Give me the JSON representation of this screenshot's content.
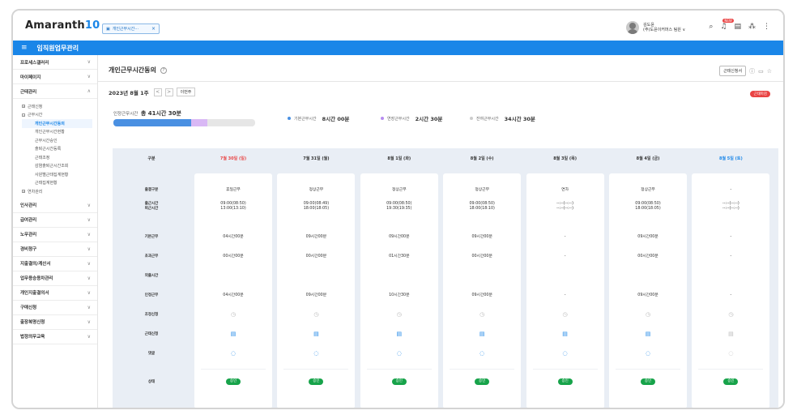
{
  "app": {
    "logo_text": "Amaranth",
    "logo_num": "10",
    "tab_label": "개인근무시간···",
    "tab_close": "×",
    "user_name": "김도윤",
    "user_dept": "(주)도윤이커머스 팀원 ∨",
    "new_badge": "NEW",
    "module_title": "임직원업무관리"
  },
  "sidebar": {
    "menus_top": [
      {
        "label": "프로세스갤러리",
        "chev": "∨"
      },
      {
        "label": "마이페이지",
        "chev": "∨"
      },
      {
        "label": "근태관리",
        "chev": "∧"
      }
    ],
    "sub_items": [
      {
        "label": "근태신청",
        "marker": "+",
        "child": false,
        "active": false
      },
      {
        "label": "근무시간",
        "marker": "−",
        "child": false,
        "active": false
      },
      {
        "label": "개인근무시간동의",
        "marker": "",
        "child": true,
        "active": true
      },
      {
        "label": "개인근무시간현황",
        "marker": "",
        "child": true,
        "active": false
      },
      {
        "label": "근무시간승인",
        "marker": "",
        "child": true,
        "active": false
      },
      {
        "label": "출퇴근시간등록",
        "marker": "",
        "child": true,
        "active": false
      },
      {
        "label": "근태조정",
        "marker": "",
        "child": true,
        "active": false
      },
      {
        "label": "감염출퇴근시간조회",
        "marker": "",
        "child": true,
        "active": false
      },
      {
        "label": "사원별근태집계현황",
        "marker": "",
        "child": true,
        "active": false
      },
      {
        "label": "근태집계현황",
        "marker": "",
        "child": true,
        "active": false
      },
      {
        "label": "연차관리",
        "marker": "+",
        "child": false,
        "active": false
      }
    ],
    "menus_bottom": [
      {
        "label": "인사관리",
        "chev": "∨"
      },
      {
        "label": "급여관리",
        "chev": "∨"
      },
      {
        "label": "노무관리",
        "chev": "∨"
      },
      {
        "label": "경비청구",
        "chev": "∨"
      },
      {
        "label": "지출결의/계산서",
        "chev": "∨"
      },
      {
        "label": "업무용승용차관리",
        "chev": "∨"
      },
      {
        "label": "개인지출결의서",
        "chev": "∨"
      },
      {
        "label": "구매신청",
        "chev": "∨"
      },
      {
        "label": "출장복명신청",
        "chev": "∨"
      },
      {
        "label": "법정의무교육",
        "chev": "∨"
      }
    ]
  },
  "page": {
    "title": "개인근무시간동의",
    "help": "?",
    "request_button": "근태신청서",
    "week_label": "2023년 8월 1주",
    "prev": "<",
    "next": ">",
    "this_week_button": "이번주",
    "status_badge": "근태마감"
  },
  "summary": {
    "total_label": "인정근무시간",
    "total_value": "총 41시간 30분",
    "basic_ratio": 0.55,
    "extend_ratio": 0.11,
    "legend": [
      {
        "label": "기본근무시간",
        "value": "8시간 00분",
        "color": "#4a90e2"
      },
      {
        "label": "연장근무시간",
        "value": "2시간 30분",
        "color": "#b68cf0"
      },
      {
        "label": "잔여근무시간",
        "value": "34시간 30분",
        "color": "#cccccc"
      }
    ]
  },
  "table": {
    "header_label": "구분",
    "row_labels": [
      "출결구분",
      "출근시간\n퇴근시간",
      "기본근무",
      "초과근무",
      "외출시간",
      "인정근무",
      "조정신청",
      "근태신청",
      "댓글",
      "상태"
    ],
    "days": [
      {
        "date": "7월 30일 (일)",
        "kind": "sun",
        "type": "휴일근무",
        "times": "09:00(08:50)\n13:00(13:10)",
        "basic": "04시간00분",
        "over": "00시간00분",
        "recognized": "04시간00분",
        "status": "승인",
        "doc_grey": false,
        "chat_grey": false
      },
      {
        "date": "7월 31일 (월)",
        "kind": "week",
        "type": "정상근무",
        "times": "09:00(08:49)\n18:00(18:05)",
        "basic": "09시간00분",
        "over": "00시간00분",
        "recognized": "09시간00분",
        "status": "승인",
        "doc_grey": false,
        "chat_grey": false
      },
      {
        "date": "8월 1일 (화)",
        "kind": "week",
        "type": "정상근무",
        "times": "09:00(08:50)\n19:30(19:35)",
        "basic": "09시간00분",
        "over": "01시간30분",
        "recognized": "10시간30분",
        "status": "승인",
        "doc_grey": false,
        "chat_grey": false
      },
      {
        "date": "8월 2일 (수)",
        "kind": "week",
        "type": "정상근무",
        "times": "09:00(08:50)\n18:00(18:10)",
        "basic": "09시간00분",
        "over": "00시간00분",
        "recognized": "09시간00분",
        "status": "승인",
        "doc_grey": false,
        "chat_grey": false
      },
      {
        "date": "8월 3일 (목)",
        "kind": "week",
        "type": "연차",
        "times": "--:--(--:--)\n--:--(--:--)",
        "basic": "-",
        "over": "-",
        "recognized": "-",
        "status": "승인",
        "doc_grey": false,
        "chat_grey": false
      },
      {
        "date": "8월 4일 (금)",
        "kind": "week",
        "type": "정상근무",
        "times": "09:00(08:50)\n18:00(18:05)",
        "basic": "09시간00분",
        "over": "00시간00분",
        "recognized": "09시간00분",
        "status": "승인",
        "doc_grey": false,
        "chat_grey": false
      },
      {
        "date": "8월 5일 (토)",
        "kind": "sat",
        "type": "-",
        "times": "--:--(--:--)\n--:--(--:--)",
        "basic": "-",
        "over": "-",
        "recognized": "-",
        "status": "승인",
        "doc_grey": true,
        "chat_grey": true
      }
    ],
    "icons": {
      "adjust": "clock-icon",
      "request": "document-icon",
      "comment": "chat-bubble-icon"
    }
  },
  "colors": {
    "accent": "#1a86e8",
    "approved": "#17a34a",
    "sunday": "#e94343",
    "saturday": "#1a86e8"
  }
}
